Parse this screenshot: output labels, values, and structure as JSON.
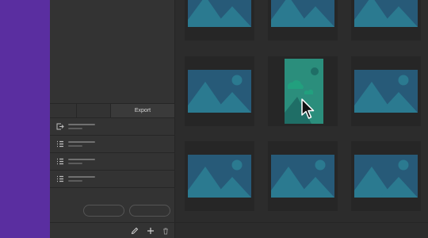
{
  "colors": {
    "sidebar_accent": "#5a2ea0",
    "panel_bg": "#333333",
    "thumbnail_bg": "#275a78",
    "thumbnail_fg": "#2b7a90",
    "selected_bg": "#2b8e7c",
    "selected_fg": "#1f6e66",
    "selected_cloud": "#22a07e"
  },
  "panel": {
    "tabs": [
      "",
      "",
      "Export"
    ],
    "list_items": [
      {
        "icon": "export-icon"
      },
      {
        "icon": "list-icon"
      },
      {
        "icon": "list-icon"
      },
      {
        "icon": "list-icon"
      }
    ],
    "toolbar_icons": [
      "pencil-icon",
      "plus-icon",
      "trash-icon"
    ]
  },
  "grid": {
    "thumbnails": 9,
    "selected_index": 4,
    "thumbnail_icon": "image-placeholder-icon"
  },
  "cursor": {
    "icon": "mouse-pointer-icon"
  }
}
